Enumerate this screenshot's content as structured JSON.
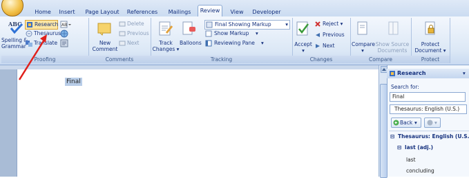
{
  "tabs": [
    "Home",
    "Insert",
    "Page Layout",
    "References",
    "Mailings",
    "Review",
    "View",
    "Developer"
  ],
  "active_tab": "Review",
  "ribbon": {
    "proofing": {
      "spelling": [
        "Spelling &",
        "Grammar"
      ],
      "research": "Research",
      "thesaurus": "Thesaurus",
      "translate": "Translate",
      "group": "Proofing"
    },
    "comments": {
      "new_comment": [
        "New",
        "Comment"
      ],
      "delete": "Delete",
      "previous": "Previous",
      "next": "Next",
      "group": "Comments"
    },
    "tracking": {
      "track_changes": [
        "Track",
        "Changes"
      ],
      "balloons": "Balloons",
      "final_showing": "Final Showing Markup",
      "show_markup": "Show Markup",
      "reviewing_pane": "Reviewing Pane",
      "group": "Tracking"
    },
    "changes": {
      "accept": "Accept",
      "reject": "Reject",
      "previous": "Previous",
      "next": "Next",
      "group": "Changes"
    },
    "compare": {
      "compare": "Compare",
      "show_source": [
        "Show Source",
        "Documents"
      ],
      "group": "Compare"
    },
    "protect": {
      "protect_doc": [
        "Protect",
        "Document"
      ],
      "group": "Protect"
    }
  },
  "document": {
    "selected_word": "Final"
  },
  "research_pane": {
    "title": "Research",
    "search_for_label": "Search for:",
    "search_value": "Final",
    "source": "Thesaurus: English (U.S.)",
    "back": "Back",
    "section_title": "Thesaurus: English (U.S.)",
    "entry": "last (adj.)",
    "results": [
      "last",
      "concluding"
    ]
  },
  "colors": {
    "accent": "#15317e",
    "annotation_arrow": "#e0201b",
    "ribbon": "#dce8f6"
  }
}
